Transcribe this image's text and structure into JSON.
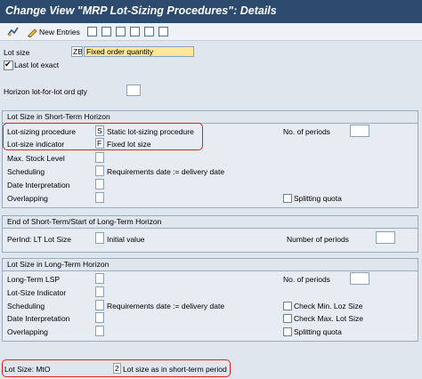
{
  "window": {
    "title": "Change View \"MRP Lot-Sizing Procedures\": Details"
  },
  "toolbar": {
    "new_entries": "New Entries"
  },
  "header": {
    "lot_size_label": "Lot size",
    "lot_size_code": "ZB",
    "lot_size_desc": "Fixed order quantity",
    "last_lot_exact_label": "Last lot exact",
    "last_lot_exact_checked": true,
    "horizon_label": "Horizon",
    "horizon_sublabel": "lot-for-lot ord qty",
    "horizon_value": ""
  },
  "short_term": {
    "title": "Lot Size in Short-Term Horizon",
    "lot_sizing_procedure_label": "Lot-sizing procedure",
    "lot_sizing_procedure_code": "S",
    "lot_sizing_procedure_desc": "Static lot-sizing procedure",
    "lot_size_indicator_label": "Lot-size indicator",
    "lot_size_indicator_code": "F",
    "lot_size_indicator_desc": "Fixed lot size",
    "no_of_periods_label": "No. of periods",
    "no_of_periods_value": "",
    "max_stock_level_label": "Max. Stock Level",
    "scheduling_label": "Scheduling",
    "scheduling_desc": "Requirements date := delivery date",
    "date_interpretation_label": "Date Interpretation",
    "overlapping_label": "Overlapping",
    "splitting_quota_label": "Splitting quota"
  },
  "end_start": {
    "title": "End of Short-Term/Start of Long-Term Horizon",
    "perind_label": "PerInd: LT Lot Size",
    "perind_desc": "Initial value",
    "number_of_periods_label": "Number of periods",
    "number_of_periods_value": ""
  },
  "long_term": {
    "title": "Lot Size in Long-Term Horizon",
    "long_term_lsp_label": "Long-Term LSP",
    "no_of_periods_label": "No. of periods",
    "lot_size_indicator_label": "Lot-Size Indicator",
    "scheduling_label": "Scheduling",
    "scheduling_desc": "Requirements date := delivery date",
    "check_min_label": "Check Min. Loz Size",
    "date_interpretation_label": "Date Interpretation",
    "check_max_label": "Check Max. Lot Size",
    "overlapping_label": "Overlapping",
    "splitting_quota_label": "Splitting quota"
  },
  "mto": {
    "label": "Lot Size: MtO",
    "code": "2",
    "desc": "Lot size as in short-term period"
  },
  "colors": {
    "title_bar": "#2c4a6b",
    "highlight_field": "#ffe79b",
    "annotation_box": "#e02020"
  }
}
